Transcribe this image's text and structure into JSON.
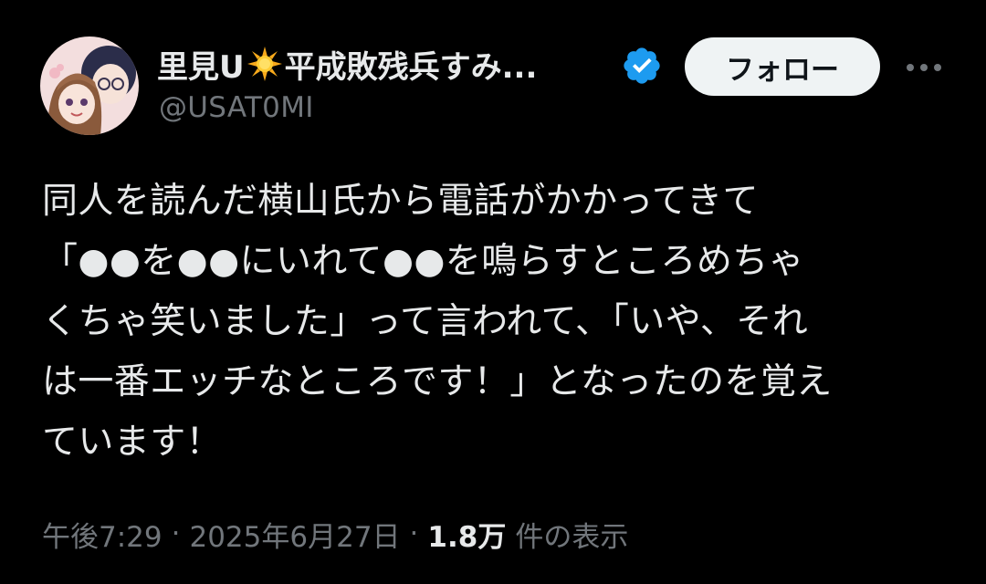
{
  "author": {
    "name_prefix": "里見U",
    "name_suffix": "平成敗残兵すみ...",
    "emoji_icon": "sun-emoji",
    "handle": "@USAT0MI",
    "verified": true,
    "verified_color": "#1d9bf0"
  },
  "actions": {
    "follow_label": "フォロー",
    "more_icon": "more-horizontal-icon"
  },
  "tweet": {
    "lines": [
      "同人を読んだ横山氏から電話がかかってきて",
      "「●●を●●にいれて●●を鳴らすところめちゃ",
      "くちゃ笑いました」って言われて、「いや、それ",
      "は一番エッチなところです！」となったのを覚え",
      "ています！"
    ]
  },
  "meta": {
    "time": "午後7:29",
    "separator": "·",
    "date": "2025年6月27日",
    "views_count": "1.8万",
    "views_label": "件の表示"
  },
  "colors": {
    "background": "#000000",
    "primary_text": "#e7e9ea",
    "secondary_text": "#71767b",
    "follow_button_bg": "#eff3f4"
  }
}
